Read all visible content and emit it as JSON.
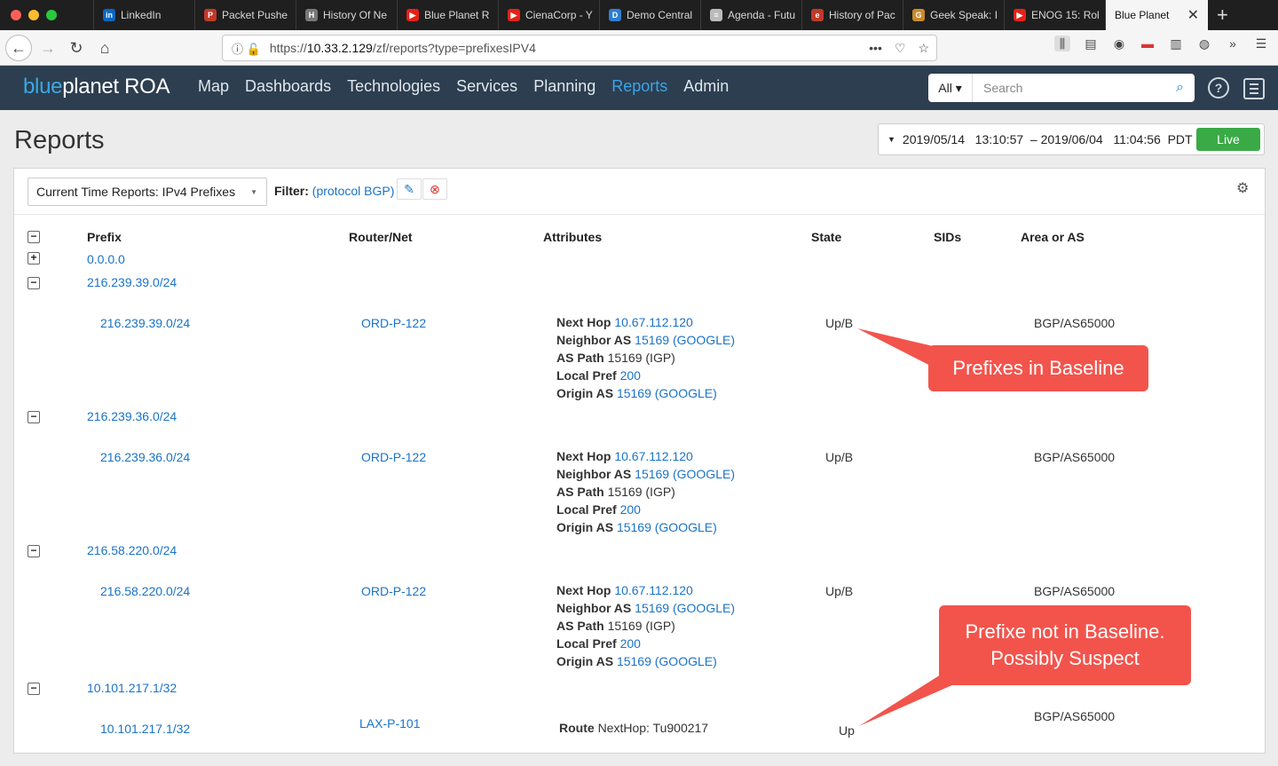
{
  "browser": {
    "tabs": [
      {
        "label": "LinkedIn",
        "icon": "linkedin-icon",
        "color": "#0a66c2",
        "glyph": "in"
      },
      {
        "label": "Packet Pushe",
        "icon": "packet-pushers-icon",
        "color": "#c0392b",
        "glyph": "P"
      },
      {
        "label": "History Of Ne",
        "icon": "history-icon",
        "color": "#777777",
        "glyph": "H"
      },
      {
        "label": "Blue Planet R",
        "icon": "youtube-icon",
        "color": "#e62117",
        "glyph": "▶"
      },
      {
        "label": "CienaCorp - Y",
        "icon": "youtube-icon",
        "color": "#e62117",
        "glyph": "▶"
      },
      {
        "label": "Demo Central",
        "icon": "demo-central-icon",
        "color": "#2d7dd2",
        "glyph": "D"
      },
      {
        "label": "Agenda - Futu",
        "icon": "document-icon",
        "color": "#bbbbbb",
        "glyph": "≡"
      },
      {
        "label": "History of Pac",
        "icon": "history-of-packets-icon",
        "color": "#c0392b",
        "glyph": "e"
      },
      {
        "label": "Geek Speak: I",
        "icon": "geek-speak-icon",
        "color": "#c98a2c",
        "glyph": "G"
      },
      {
        "label": "ENOG 15: Rol",
        "icon": "youtube-icon",
        "color": "#e62117",
        "glyph": "▶"
      }
    ],
    "active_tab": "Blue Planet",
    "url_prefix": "https://",
    "url_host": "10.33.2.129",
    "url_path": "/zf/reports?type=prefixesIPV4"
  },
  "app": {
    "brand_a": "blue",
    "brand_b": "planet",
    "brand_c": " ROA",
    "nav": [
      "Map",
      "Dashboards",
      "Technologies",
      "Services",
      "Planning",
      "Reports",
      "Admin"
    ],
    "active_nav": "Reports",
    "search_scope": "All",
    "search_placeholder": "Search"
  },
  "page": {
    "title": "Reports",
    "time_range": "2019/05/14   13:10:57  – 2019/06/04   11:04:56  PDT",
    "live_label": "Live",
    "report_select": "Current Time Reports: IPv4 Prefixes",
    "filter_label": "Filter:",
    "filter_value": "(protocol BGP)"
  },
  "table": {
    "headers": [
      "Prefix",
      "Router/Net",
      "Attributes",
      "State",
      "SIDs",
      "Area or AS"
    ],
    "top_prefix": "0.0.0.0",
    "groups": [
      {
        "prefix": "216.239.39.0/24",
        "child_prefix": "216.239.39.0/24",
        "router": "ORD-P-122",
        "state": "Up/B",
        "area": "BGP/AS65000",
        "attrs": {
          "next_hop": "10.67.112.120",
          "neighbor_as": "15169 (GOOGLE)",
          "as_path": "15169 (IGP)",
          "local_pref": "200",
          "origin_as": "15169 (GOOGLE)"
        }
      },
      {
        "prefix": "216.239.36.0/24",
        "child_prefix": "216.239.36.0/24",
        "router": "ORD-P-122",
        "state": "Up/B",
        "area": "BGP/AS65000",
        "attrs": {
          "next_hop": "10.67.112.120",
          "neighbor_as": "15169 (GOOGLE)",
          "as_path": "15169 (IGP)",
          "local_pref": "200",
          "origin_as": "15169 (GOOGLE)"
        }
      },
      {
        "prefix": "216.58.220.0/24",
        "child_prefix": "216.58.220.0/24",
        "router": "ORD-P-122",
        "state": "Up/B",
        "area": "BGP/AS65000",
        "attrs": {
          "next_hop": "10.67.112.120",
          "neighbor_as": "15169 (GOOGLE)",
          "as_path": "15169 (IGP)",
          "local_pref": "200",
          "origin_as": "15169 (GOOGLE)"
        }
      },
      {
        "prefix": "10.101.217.1/32",
        "child_prefix": "10.101.217.1/32",
        "router": "LAX-P-101",
        "state": "Up",
        "area": "BGP/AS65000",
        "route_label": "Route",
        "route_value": "NextHop: Tu900217"
      }
    ],
    "attr_labels": {
      "next_hop": "Next Hop",
      "neighbor_as": "Neighbor AS",
      "as_path": "AS Path",
      "local_pref": "Local Pref",
      "origin_as": "Origin AS"
    }
  },
  "callouts": {
    "baseline": "Prefixes in Baseline",
    "suspect_line1": "Prefixe not in Baseline.",
    "suspect_line2": "Possibly Suspect"
  }
}
